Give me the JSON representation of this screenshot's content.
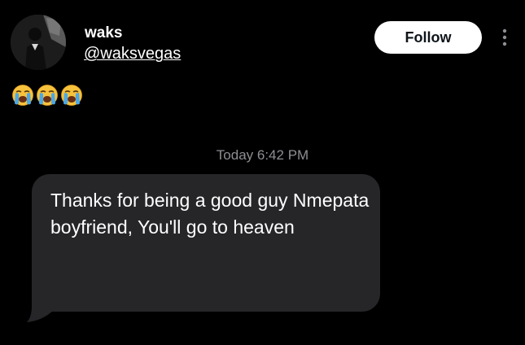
{
  "profile": {
    "display_name": "waks",
    "handle": "@waksvegas",
    "avatar": "profile-photo"
  },
  "actions": {
    "follow_label": "Follow",
    "more_icon": "more-vertical-icon"
  },
  "post": {
    "emojis": [
      "😭",
      "😭",
      "😭"
    ]
  },
  "screenshot": {
    "timestamp": "Today 6:42 PM",
    "message_text": "Thanks for being a good guy Nmepata boyfriend, You'll go to heaven"
  },
  "colors": {
    "background": "#000000",
    "bubble": "#262629",
    "timestamp": "#8e8e93",
    "follow_bg": "#ffffff",
    "follow_text": "#0f1419"
  }
}
